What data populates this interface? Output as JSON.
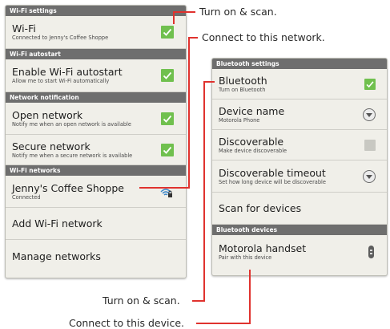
{
  "wifi_panel": {
    "sections": {
      "wifi_settings": "Wi-Fi settings",
      "wifi_autostart": "Wi-Fi autostart",
      "network_notification": "Network notification",
      "wifi_networks": "Wi-Fi networks"
    },
    "wifi": {
      "title": "Wi-Fi",
      "subtitle": "Connected to Jenny's Coffee Shoppe",
      "checked": true
    },
    "autostart": {
      "title": "Enable Wi-Fi autostart",
      "subtitle": "Allow me to start Wi-Fi automatically",
      "checked": true
    },
    "open_network": {
      "title": "Open network",
      "subtitle": "Notify me when an open network is available",
      "checked": true
    },
    "secure_network": {
      "title": "Secure network",
      "subtitle": "Notify me when a secure network is available",
      "checked": true
    },
    "network": {
      "title": "Jenny's Coffee Shoppe",
      "subtitle": "Connected",
      "icon": "wifi-lock-icon"
    },
    "add_network": "Add Wi-Fi network",
    "manage_networks": "Manage networks"
  },
  "bt_panel": {
    "sections": {
      "bluetooth_settings": "Bluetooth settings",
      "bluetooth_devices": "Bluetooth devices"
    },
    "bluetooth": {
      "title": "Bluetooth",
      "subtitle": "Turn on Bluetooth",
      "checked": true
    },
    "device_name": {
      "title": "Device name",
      "subtitle": "Motorola Phone",
      "icon": "dropdown-circle-icon"
    },
    "discoverable": {
      "title": "Discoverable",
      "subtitle": "Make device discoverable",
      "checked": false
    },
    "discoverable_timeout": {
      "title": "Discoverable timeout",
      "subtitle": "Set how long device will be discoverable",
      "icon": "dropdown-circle-icon"
    },
    "scan": "Scan for devices",
    "handset": {
      "title": "Motorola handset",
      "subtitle": "Pair with this device",
      "icon": "device-menu-icon"
    }
  },
  "callouts": {
    "wifi_turn_on": "Turn on & scan.",
    "wifi_connect": "Connect to this network.",
    "bt_turn_on": "Turn on & scan.",
    "bt_connect": "Connect to this device."
  },
  "colors": {
    "accent_line": "#e0322e",
    "checkbox_green": "#70c04e",
    "header_gray": "#6e6e6e"
  }
}
